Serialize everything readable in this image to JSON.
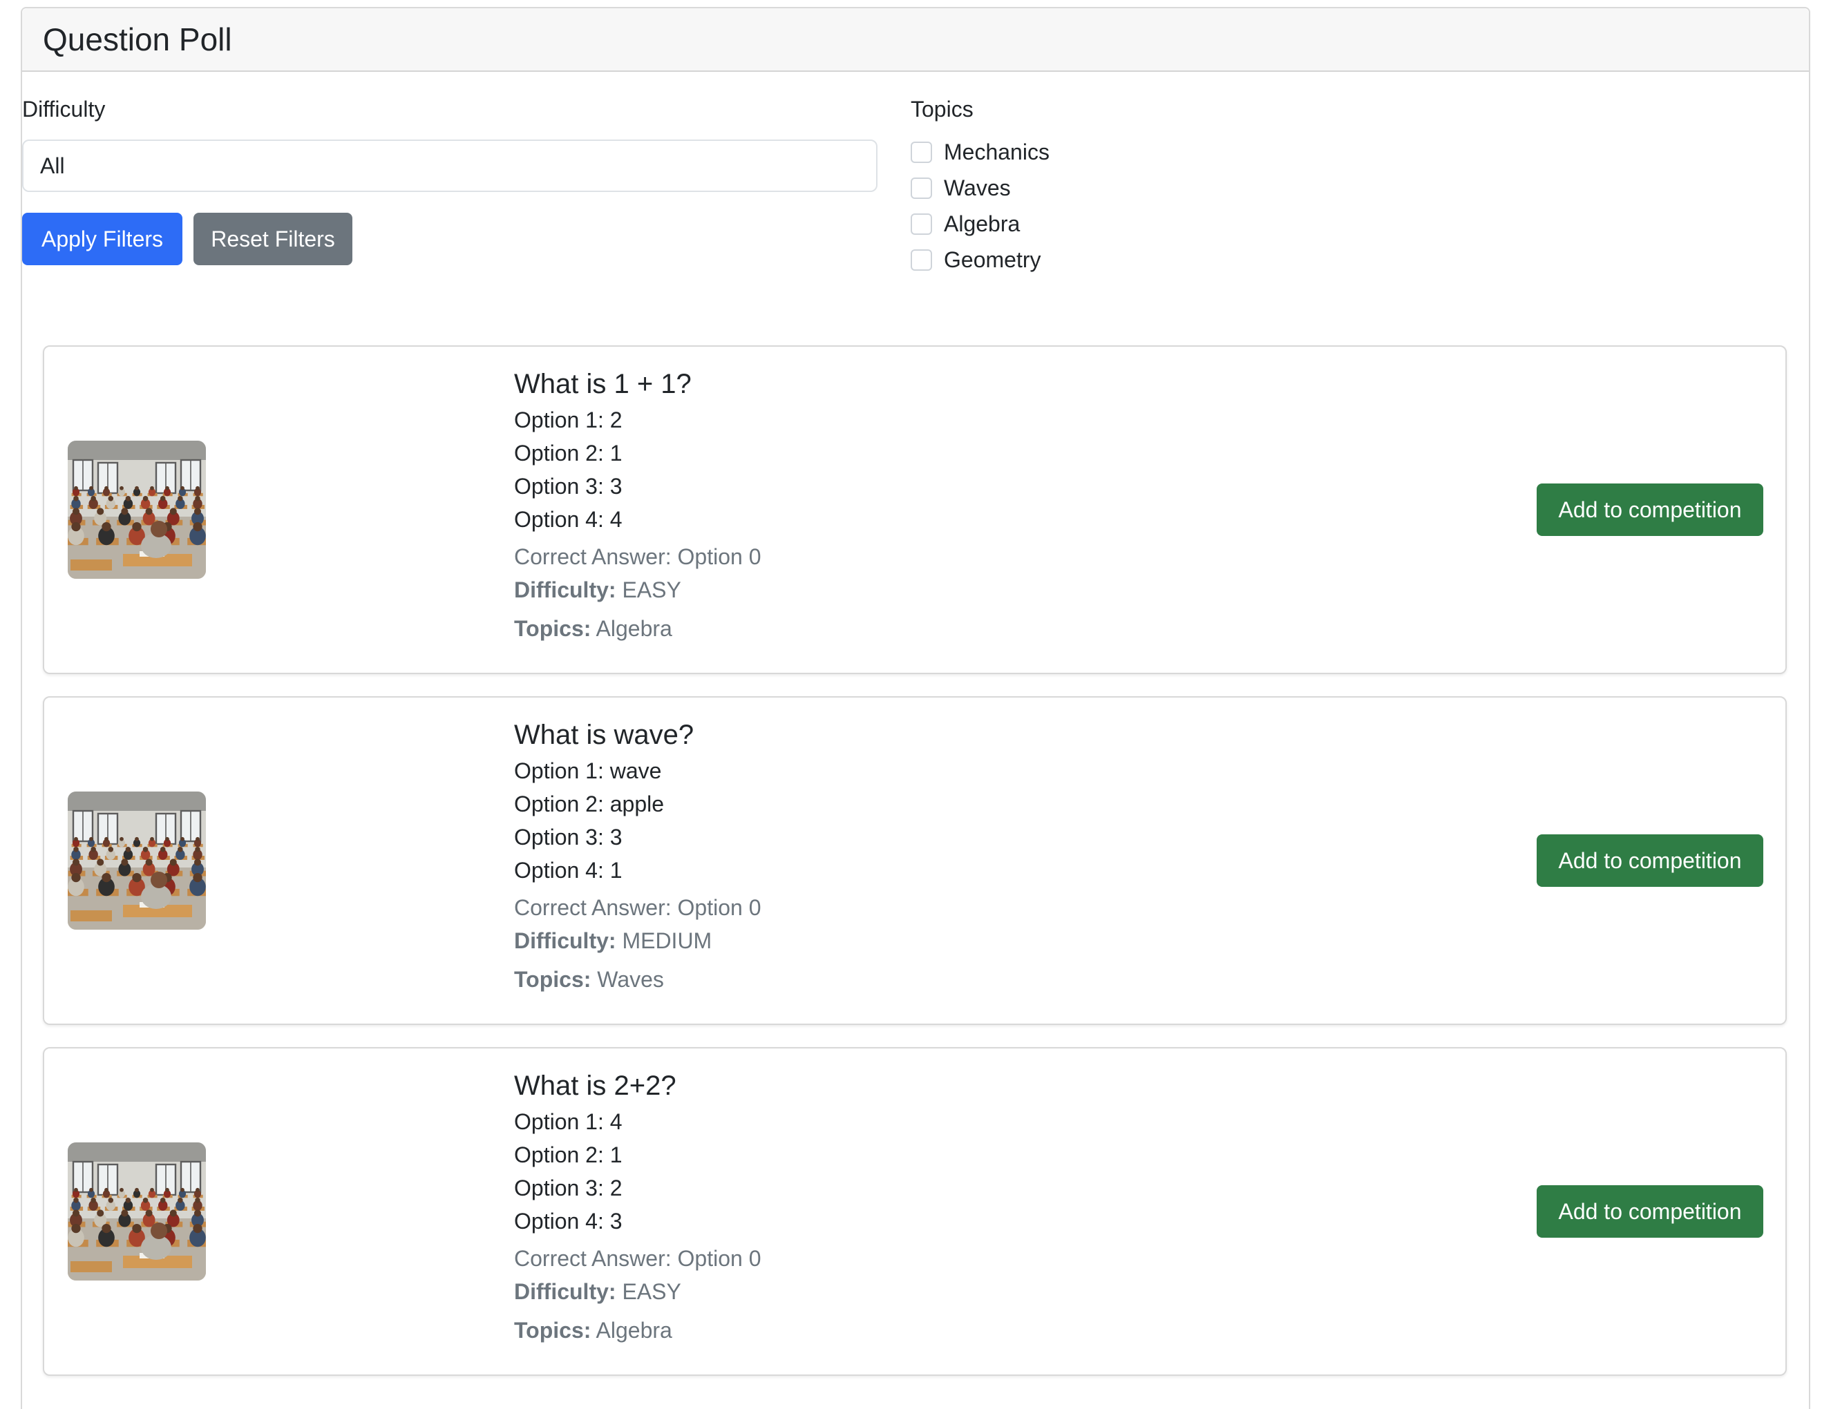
{
  "header": {
    "title": "Question Poll"
  },
  "filters": {
    "difficulty_label": "Difficulty",
    "difficulty_value": "All",
    "apply_label": "Apply Filters",
    "reset_label": "Reset Filters",
    "topics_label": "Topics",
    "topics": [
      "Mechanics",
      "Waves",
      "Algebra",
      "Geometry"
    ]
  },
  "labels": {
    "difficulty": "Difficulty:",
    "topics": "Topics:",
    "add_button": "Add to competition"
  },
  "questions": [
    {
      "title": "What is 1 + 1?",
      "options": [
        "Option 1: 2",
        "Option 2: 1",
        "Option 3: 3",
        "Option 4: 4"
      ],
      "correct_answer": "Correct Answer: Option 0",
      "difficulty": "EASY",
      "topics": "Algebra"
    },
    {
      "title": "What is wave?",
      "options": [
        "Option 1: wave",
        "Option 2: apple",
        "Option 3: 3",
        "Option 4: 1"
      ],
      "correct_answer": "Correct Answer: Option 0",
      "difficulty": "MEDIUM",
      "topics": "Waves"
    },
    {
      "title": "What is 2+2?",
      "options": [
        "Option 1: 4",
        "Option 2: 1",
        "Option 3: 2",
        "Option 4: 3"
      ],
      "correct_answer": "Correct Answer: Option 0",
      "difficulty": "EASY",
      "topics": "Algebra"
    }
  ]
}
